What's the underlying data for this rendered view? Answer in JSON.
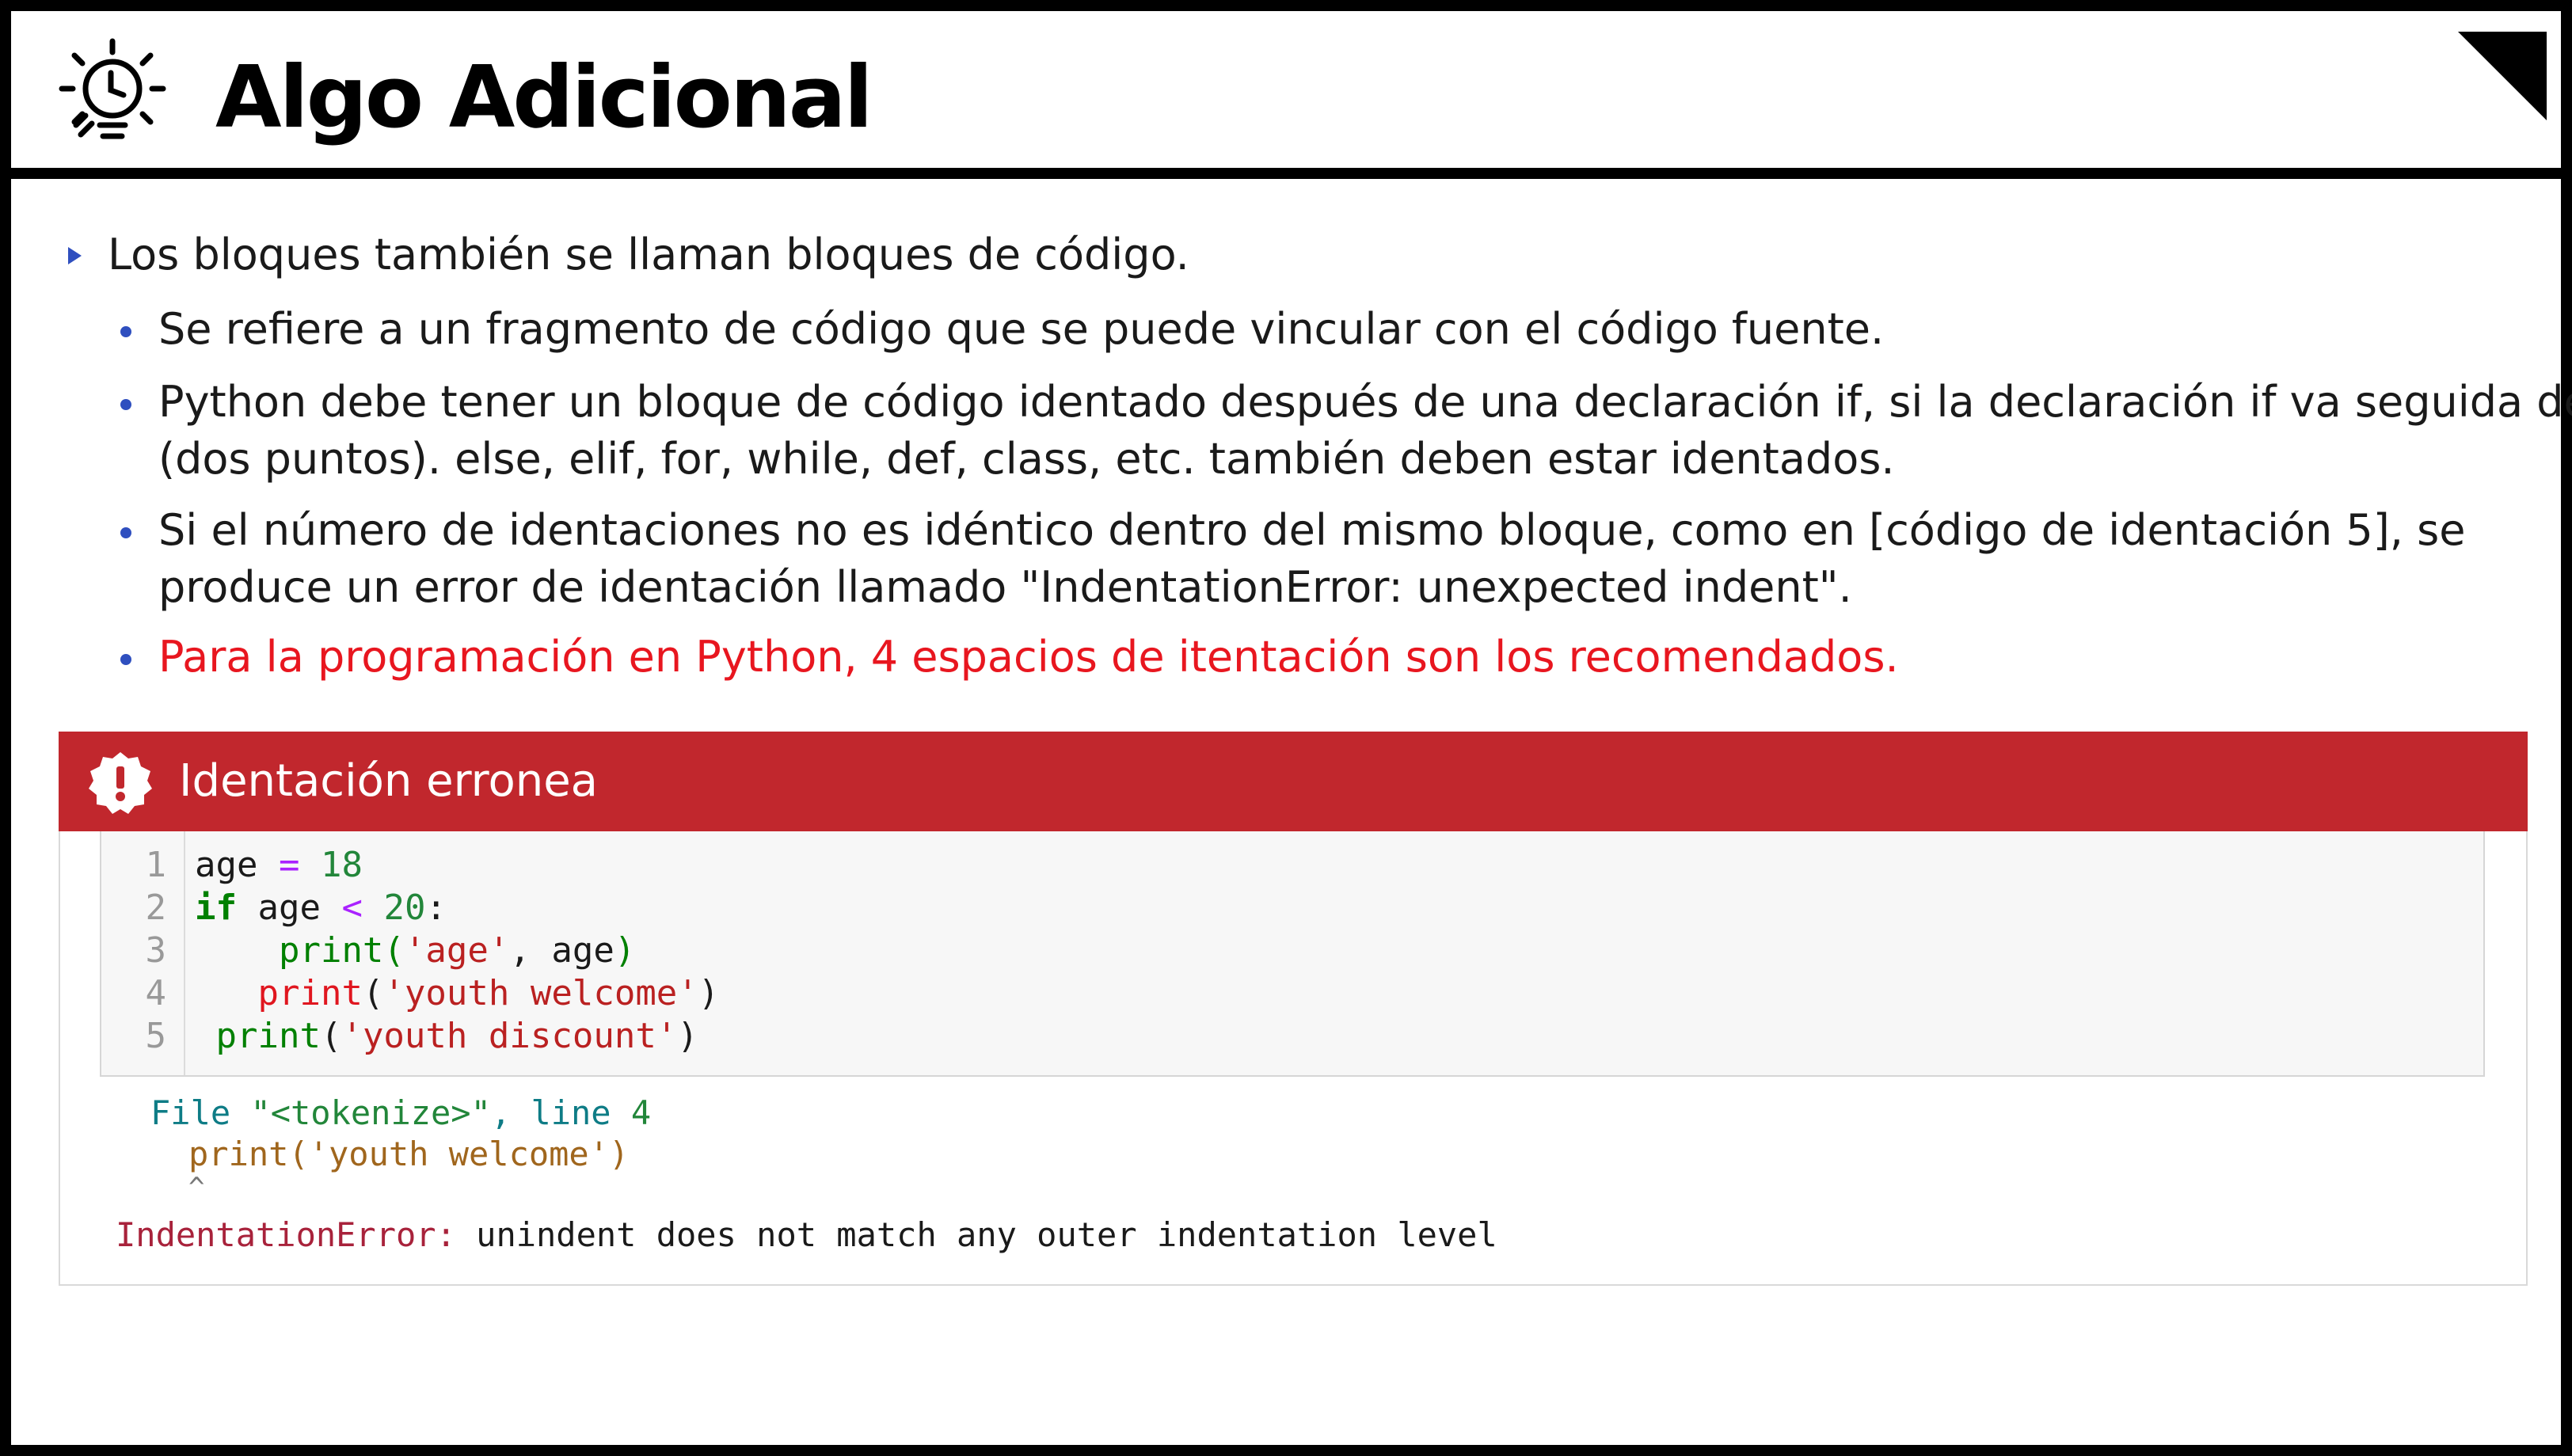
{
  "header": {
    "title": "Algo Adicional",
    "logo_icon": "lightbulb-clock-icon",
    "corner_icon": "corner-triangle-icon"
  },
  "bullets": {
    "main": "Los bloques también se llaman bloques de código.",
    "sub": [
      {
        "lines": [
          "Se refiere a un fragmento de código que se puede vincular con el código fuente."
        ]
      },
      {
        "lines": [
          "Python debe tener un bloque de código identado después de una declaración if, si la declaración if va seguida de :",
          "(dos puntos). else, elif, for, while, def, class, etc. también deben estar identados."
        ]
      },
      {
        "lines": [
          "Si el número de identaciones no es idéntico dentro del mismo bloque, como en [código de identación 5], se",
          "produce un error de identación llamado \"IndentationError: unexpected indent\"."
        ]
      },
      {
        "lines": [
          "Para la programación en Python, 4 espacios de itentación son los recomendados."
        ]
      }
    ]
  },
  "error_box": {
    "title": "Identación erronea",
    "icon": "warning-badge-icon",
    "code": {
      "line_numbers": [
        "1",
        "2",
        "3",
        "4",
        "5"
      ],
      "l1": {
        "var": "age",
        "op": "=",
        "num": "18"
      },
      "l2": {
        "kw": "if",
        "var": "age",
        "op": "<",
        "num": "20",
        "colon": ":"
      },
      "l3": {
        "indent": "    ",
        "fn": "print",
        "open": "(",
        "str": "'age'",
        "mid": ", age",
        "close": ")"
      },
      "l4": {
        "indent": "   ",
        "fn": "print",
        "open": "(",
        "str": "'youth welcome'",
        "close": ")"
      },
      "l5": {
        "indent": " ",
        "fn": "print",
        "open": "(",
        "str": "'youth discount'",
        "close": ")"
      }
    },
    "output": {
      "file_label": "File ",
      "file_name": "\"<tokenize>\"",
      "line_label": ", line ",
      "line_num": "4",
      "echo": "print('youth welcome')",
      "caret": "^",
      "error_type": "IndentationError:",
      "error_msg": " unindent does not match any outer indentation level"
    }
  }
}
